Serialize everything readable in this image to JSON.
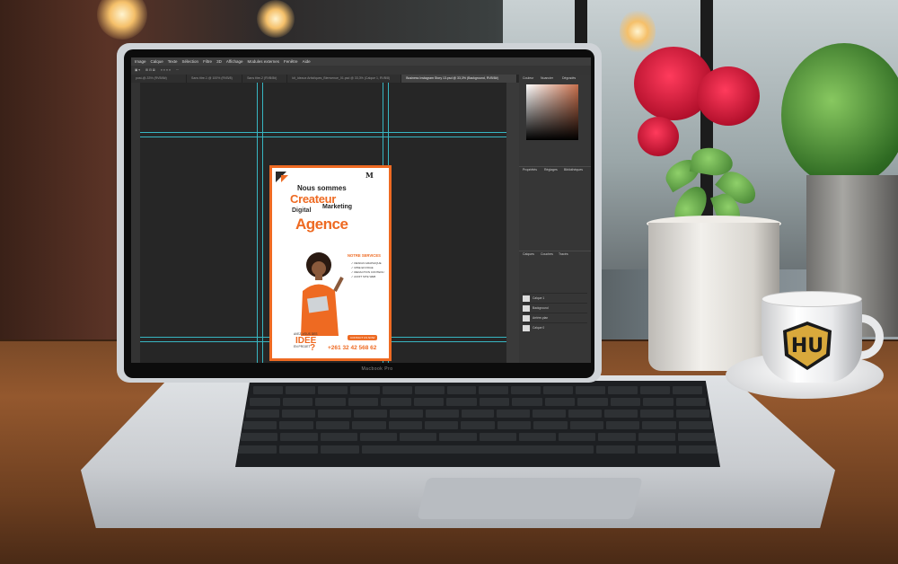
{
  "photoshop": {
    "menu": [
      "Image",
      "Calque",
      "Texte",
      "Sélection",
      "Filtre",
      "3D",
      "Affichage",
      "Modules externes",
      "Fenêtre",
      "Aide"
    ],
    "tabs": [
      {
        "label": "post-@-33% (RVB/8#)"
      },
      {
        "label": "Sans titre-1 @ 100% (RVB/8)"
      },
      {
        "label": "Sans titre-2 (RVB/8#)"
      },
      {
        "label": "kit_Ideaux Artistiques_Bienvenue_01.psd @ 33,3% (Calque 1, RVB/8)"
      },
      {
        "label": "Business Instagram Story 13.psd @ 33,3% (Background, RVB/8#)"
      }
    ],
    "panels": {
      "color_tabs": [
        "Couleur",
        "Nuancier",
        "Dégradés"
      ],
      "properties_tabs": [
        "Propriétés",
        "Réglages",
        "Bibliothèques"
      ],
      "layers_tabs": [
        "Calques",
        "Couches",
        "Tracés"
      ],
      "layers": [
        "Calque 1",
        "Background",
        "Arrière-plan",
        "Calque 0"
      ]
    }
  },
  "flyer": {
    "line1": "Nous sommes",
    "line2": "Createur",
    "line3": "Digital",
    "line4": "Marketing",
    "line5": "Agence",
    "services_title": "NOTRE SERVICES",
    "services": [
      "✓ DESIGN GRAPHIQUE",
      "✓ MISE EN PAGE",
      "✓ REDACTION CONTENU",
      "✓ AUDIT SITE WEB"
    ],
    "idee_before": "AVEZ-VOUS DES",
    "idee": "IDEE",
    "idee_after": "EN PROJET",
    "question": "?",
    "contact_label": "CONTACT US NOW",
    "phone": "+261 32 42 568 62"
  },
  "laptop": {
    "brand": "Macbook Pro"
  },
  "mug": {
    "logo_letters": "HU"
  },
  "colors": {
    "accent": "#ee6a22",
    "ps_dark": "#282828",
    "guide": "#37b6c2"
  }
}
